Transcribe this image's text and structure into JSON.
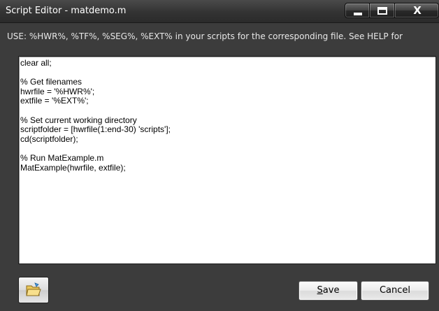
{
  "window": {
    "title": "Script Editor - matdemo.m",
    "minimize_glyph": "",
    "maximize_glyph": "",
    "close_glyph": "X"
  },
  "hint": {
    "text": "USE: %HWR%, %TF%, %SEG%, %EXT% in your scripts for the corresponding file. See HELP for"
  },
  "editor": {
    "content": "clear all;\n\n% Get filenames\nhwrfile = '%HWR%';\nextfile = '%EXT%';\n\n% Set current working directory\nscriptfolder = [hwrfile(1:end-30) 'scripts'];\ncd(scriptfolder);\n\n% Run MatExample.m\nMatExample(hwrfile, extfile);"
  },
  "buttons": {
    "open_icon": "folder-open-icon",
    "save_accel": "S",
    "save_rest": "ave",
    "cancel_label": "Cancel"
  },
  "colors": {
    "titlebar": "#333333",
    "client": "#3c3c3c",
    "hint_text": "#e8e8e8",
    "editor_bg": "#ffffff"
  }
}
